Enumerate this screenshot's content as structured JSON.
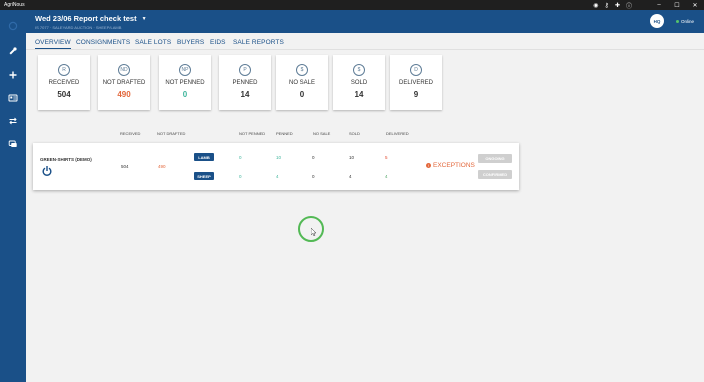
{
  "os": {
    "app_name": "AgriNous",
    "minimize": "–",
    "maximize": "☐",
    "close": "✕"
  },
  "header": {
    "sale_title": "Wed 23/06 Report check test",
    "sale_subtitle": "IS 7077 · SALEYARD AUCTION · SHEEP/LAMB",
    "user_initials": "HQ",
    "connection_status": "Online"
  },
  "tabs": [
    {
      "label": "OVERVIEW"
    },
    {
      "label": "CONSIGNMENTS"
    },
    {
      "label": "SALE LOTS"
    },
    {
      "label": "BUYERS"
    },
    {
      "label": "EIDS"
    },
    {
      "label": "SALE REPORTS"
    }
  ],
  "stats": [
    {
      "label": "RECEIVED",
      "value": "504",
      "icon": "R"
    },
    {
      "label": "NOT DRAFTED",
      "value": "490",
      "icon": "ND"
    },
    {
      "label": "NOT PENNED",
      "value": "0",
      "icon": "NP"
    },
    {
      "label": "PENNED",
      "value": "14",
      "icon": "P"
    },
    {
      "label": "NO SALE",
      "value": "0",
      "icon": "$"
    },
    {
      "label": "SOLD",
      "value": "14",
      "icon": "$"
    },
    {
      "label": "DELIVERED",
      "value": "9",
      "icon": "D"
    }
  ],
  "columns": {
    "received": "RECEIVED",
    "not_drafted": "NOT DRAFTED",
    "not_penned": "NOT PENNED",
    "penned": "PENNED",
    "no_sale": "NO SALE",
    "sold": "SOLD",
    "delivered": "DELIVERED"
  },
  "vendor_row": {
    "vendor": "GREEN-SHIRTS (DEMO)",
    "received": "504",
    "not_drafted": "490",
    "lamb": {
      "label": "LAMB",
      "not_penned": "0",
      "penned": "10",
      "no_sale": "0",
      "sold": "10",
      "delivered": "5"
    },
    "sheep": {
      "label": "SHEEP",
      "not_penned": "0",
      "penned": "4",
      "no_sale": "0",
      "sold": "4",
      "delivered": "4"
    },
    "exceptions_label": "EXCEPTIONS",
    "ongoing_label": "ONGOING",
    "confirmed_label": "CONFIRMED"
  },
  "colors": {
    "brand_blue": "#1a5088",
    "accent_orange": "#e3673b",
    "accent_teal": "#3fb59c",
    "online_green": "#56c26b"
  }
}
